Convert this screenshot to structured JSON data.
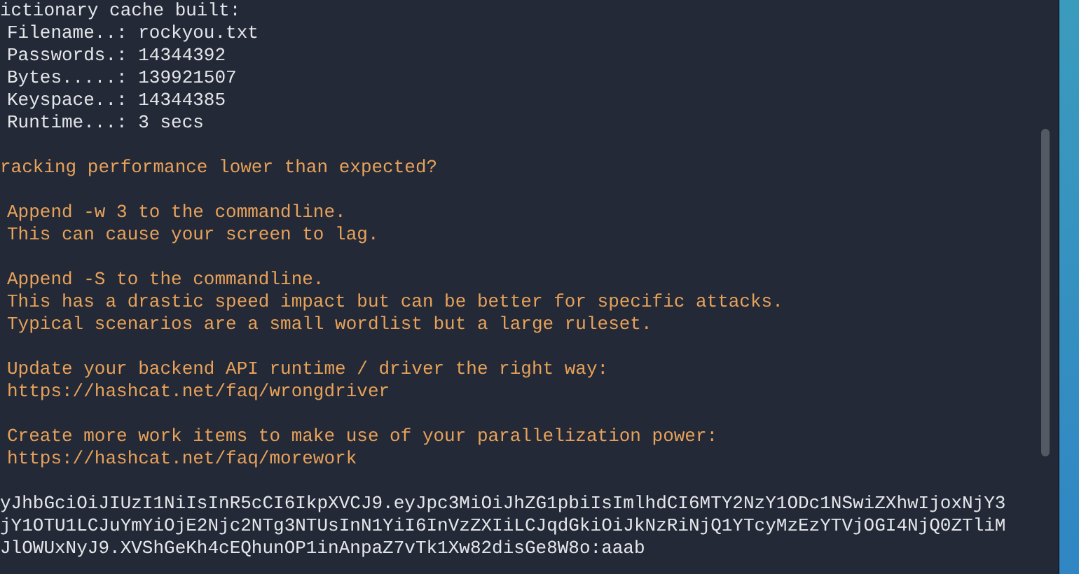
{
  "terminal": {
    "lines": [
      {
        "kind": "plain",
        "text": "ictionary cache built:"
      },
      {
        "kind": "plain",
        "text": "Filename..: rockyou.txt",
        "indented": true
      },
      {
        "kind": "plain",
        "text": "Passwords.: 14344392",
        "indented": true
      },
      {
        "kind": "plain",
        "text": "Bytes.....: 139921507",
        "indented": true
      },
      {
        "kind": "plain",
        "text": "Keyspace..: 14344385",
        "indented": true
      },
      {
        "kind": "plain",
        "text": "Runtime...: 3 secs",
        "indented": true
      },
      {
        "kind": "blank"
      },
      {
        "kind": "warning",
        "text": "racking performance lower than expected?"
      },
      {
        "kind": "blank"
      },
      {
        "kind": "warning",
        "text": "Append -w 3 to the commandline.",
        "indented": true
      },
      {
        "kind": "warning",
        "text": "This can cause your screen to lag.",
        "indented": true
      },
      {
        "kind": "blank"
      },
      {
        "kind": "warning",
        "text": "Append -S to the commandline.",
        "indented": true
      },
      {
        "kind": "warning",
        "text": "This has a drastic speed impact but can be better for specific attacks.",
        "indented": true
      },
      {
        "kind": "warning",
        "text": "Typical scenarios are a small wordlist but a large ruleset.",
        "indented": true
      },
      {
        "kind": "blank"
      },
      {
        "kind": "warning",
        "text": "Update your backend API runtime / driver the right way:",
        "indented": true
      },
      {
        "kind": "warning",
        "text": "https://hashcat.net/faq/wrongdriver",
        "indented": true
      },
      {
        "kind": "blank"
      },
      {
        "kind": "warning",
        "text": "Create more work items to make use of your parallelization power:",
        "indented": true
      },
      {
        "kind": "warning",
        "text": "https://hashcat.net/faq/morework",
        "indented": true
      },
      {
        "kind": "blank"
      },
      {
        "kind": "plain",
        "text": "yJhbGciOiJIUzI1NiIsInR5cCI6IkpXVCJ9.eyJpc3MiOiJhZG1pbiIsImlhdCI6MTY2NzY1ODc1NSwiZXhwIjoxNjY3"
      },
      {
        "kind": "plain",
        "text": "jY1OTU1LCJuYmYiOjE2Njc2NTg3NTUsInN1YiI6InVzZXIiLCJqdGkiOiJkNzRiNjQ1YTcyMzEzYTVjOGI4NjQ0ZTliM"
      },
      {
        "kind": "plain",
        "text": "JlOWUxNyJ9.XVShGeKh4cEQhunOP1inAnpaZ7vTk1Xw82disGe8W8o:aaab"
      }
    ]
  }
}
